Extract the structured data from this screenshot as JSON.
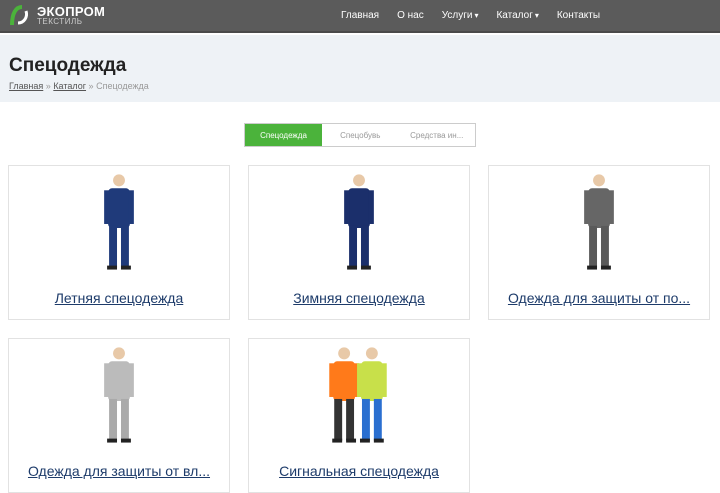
{
  "header": {
    "brand": "ЭКОПРОМ",
    "brand_sub": "ТЕКСТИЛЬ",
    "nav": [
      {
        "label": "Главная"
      },
      {
        "label": "О нас"
      },
      {
        "label": "Услуги",
        "dropdown": true
      },
      {
        "label": "Каталог",
        "dropdown": true
      },
      {
        "label": "Контакты"
      }
    ]
  },
  "page": {
    "title": "Спецодежда",
    "breadcrumb": [
      "Главная",
      "Каталог",
      "Спецодежда"
    ],
    "separator": "»"
  },
  "tabs": [
    {
      "label": "Спецодежда",
      "active": true
    },
    {
      "label": "Спецобувь"
    },
    {
      "label": "Средства ин..."
    }
  ],
  "categories": [
    {
      "label": "Летняя спецодежда"
    },
    {
      "label": "Зимняя спецодежда"
    },
    {
      "label": "Одежда для защиты от по..."
    },
    {
      "label": "Одежда для защиты от вл..."
    },
    {
      "label": "Сигнальная спецодежда"
    }
  ],
  "colors": {
    "accent": "#4bb33b",
    "header_bg": "#5b5b5b",
    "link": "#1d3b6a"
  }
}
